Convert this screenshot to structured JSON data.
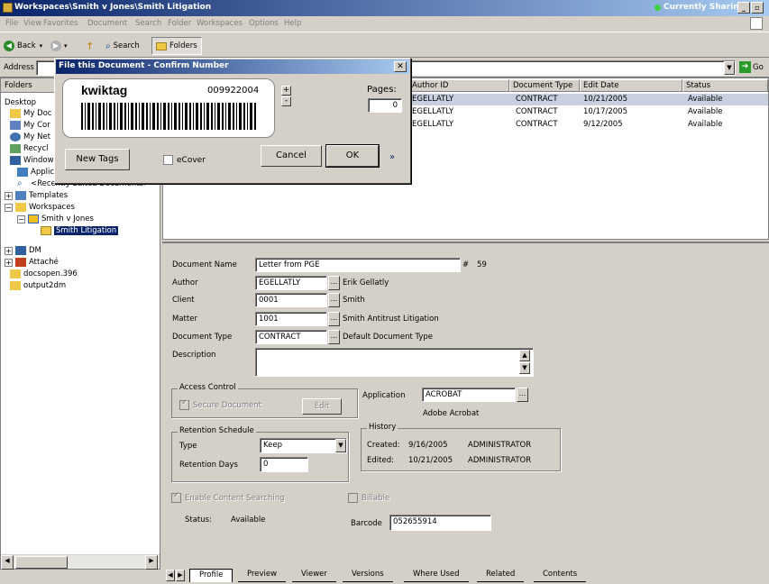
{
  "window": {
    "title": "Workspaces\\Smith v Jones\\Smith Litigation",
    "sharing": "Currently Sharing"
  },
  "menu": [
    "File",
    "View",
    "Favorites",
    "Document",
    "Search",
    "Folder",
    "Workspaces",
    "Options",
    "Help"
  ],
  "toolbar": {
    "back": "Back",
    "search": "Search",
    "folders": "Folders"
  },
  "address": {
    "label": "Address",
    "go": "Go"
  },
  "folders": {
    "header": "Folders",
    "items": {
      "desktop": "Desktop",
      "mydocs": "My Doc",
      "mycomp": "My Cor",
      "mynet": "My Net",
      "recycle": "Recycl",
      "windows": "Window",
      "applications": "Applications",
      "recent": "<Recently Edited Documents>",
      "templates": "Templates",
      "workspaces": "Workspaces",
      "smithjones": "Smith v Jones",
      "smithlit": "Smith Litigation",
      "dm": "DM",
      "attache": "Attaché",
      "docsopen": "docsopen.396",
      "output": "output2dm"
    }
  },
  "list": {
    "headers": {
      "author": "Author ID",
      "doctype": "Document Type",
      "editdate": "Edit Date",
      "status": "Status"
    },
    "rows": [
      {
        "author": "EGELLATLY",
        "doctype": "CONTRACT",
        "editdate": "10/21/2005",
        "status": "Available"
      },
      {
        "author": "EGELLATLY",
        "doctype": "CONTRACT",
        "editdate": "10/17/2005",
        "status": "Available"
      },
      {
        "author": "EGELLATLY",
        "doctype": "CONTRACT",
        "editdate": "9/12/2005",
        "status": "Available"
      }
    ]
  },
  "profile": {
    "doc_name_label": "Document Name",
    "doc_name": "Letter from PGE",
    "hash": "#",
    "doc_number": "59",
    "author_label": "Author",
    "author": "EGELLATLY",
    "author_name": "Erik Gellatly",
    "client_label": "Client",
    "client": "0001",
    "client_name": "Smith",
    "matter_label": "Matter",
    "matter": "1001",
    "matter_name": "Smith Antitrust Litigation",
    "doctype_label": "Document Type",
    "doctype": "CONTRACT",
    "doctype_name": "Default Document Type",
    "description_label": "Description",
    "access_control": "Access Control",
    "secure_document": "Secure Document",
    "edit": "Edit",
    "application_label": "Application",
    "application": "ACROBAT",
    "application_name": "Adobe Acrobat",
    "retention": "Retention Schedule",
    "type_label": "Type",
    "type_value": "Keep",
    "retention_days_label": "Retention Days",
    "retention_days": "0",
    "history": "History",
    "created_label": "Created:",
    "created_date": "9/16/2005",
    "created_by": "ADMINISTRATOR",
    "edited_label": "Edited:",
    "edited_date": "10/21/2005",
    "edited_by": "ADMINISTRATOR",
    "enable_search": "Enable Content Searching",
    "billable": "Billable",
    "status_label": "Status:",
    "status": "Available",
    "barcode_label": "Barcode",
    "barcode": "052655914",
    "ellipsis": "..."
  },
  "tabs": [
    "Profile",
    "Preview",
    "Viewer",
    "Versions",
    "Where Used",
    "Related",
    "Contents"
  ],
  "dialog": {
    "title": "File this Document - Confirm Number",
    "logo": "kwiktag",
    "number": "009922004",
    "pages_label": "Pages:",
    "pages": "0",
    "new_tags": "New Tags",
    "ecover": "eCover",
    "cancel": "Cancel",
    "ok": "OK",
    "plus": "+",
    "minus": "-"
  },
  "colors": {
    "titlebar": "#0a246a",
    "selection": "#0a246a",
    "window_bg": "#d4d0c8"
  }
}
